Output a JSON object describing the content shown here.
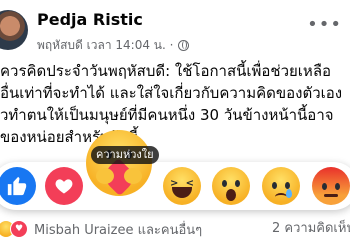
{
  "post": {
    "author": "Pedja Ristic",
    "timestamp": "พฤหัสบดี เวลา 14:04 น. ·",
    "privacy_icon": "globe-icon",
    "more_icon": "more-options-icon",
    "text_lines": [
      "ควรคิดประจำวันพฤหัสบดี: ใช้โอกาสนี้เพื่อช่วยเหลือ",
      "อื่นเท่าที่จะทำได้ และใส่ใจเกี่ยวกับความคิดของตัวเอง",
      "วทำตนให้เป็นมนุษย์ที่มีคนหนึ่ง 30 วันข้างหน้านี้อาจ",
      "ของหน่อยสำหรับวันนี้"
    ]
  },
  "reactions": {
    "hover_tooltip": "ความห่วงใย",
    "items": [
      {
        "name": "like",
        "icon": "thumbs-up-icon",
        "color": "#1877f2"
      },
      {
        "name": "love",
        "icon": "heart-icon",
        "color": "#f33e58"
      },
      {
        "name": "care",
        "icon": "care-emoji-icon",
        "color": "#f7b125"
      },
      {
        "name": "haha",
        "icon": "haha-emoji-icon",
        "color": "#f7b125"
      },
      {
        "name": "wow",
        "icon": "wow-emoji-icon",
        "color": "#f7b125"
      },
      {
        "name": "sad",
        "icon": "sad-emoji-icon",
        "color": "#f7b125"
      },
      {
        "name": "angry",
        "icon": "angry-emoji-icon",
        "color": "#e9302b"
      }
    ]
  },
  "footer": {
    "reactors_text": "Misbah Uraizee และคนอื่นๆ",
    "comments_text": "2 ความคิดเห็น"
  }
}
